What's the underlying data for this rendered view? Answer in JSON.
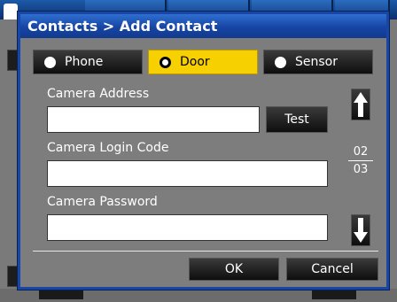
{
  "dialog": {
    "title": "Contacts > Add Contact",
    "types": [
      {
        "label": "Phone",
        "selected": false
      },
      {
        "label": "Door",
        "selected": true
      },
      {
        "label": "Sensor",
        "selected": false
      }
    ],
    "fields": {
      "camera_address": {
        "label": "Camera Address",
        "value": ""
      },
      "camera_login_code": {
        "label": "Camera Login Code",
        "value": ""
      },
      "camera_password": {
        "label": "Camera Password",
        "value": ""
      }
    },
    "test_label": "Test",
    "page": {
      "current": "02",
      "total": "03"
    },
    "ok_label": "OK",
    "cancel_label": "Cancel"
  },
  "colors": {
    "title_bar": "#1745a4",
    "selected_type": "#f6d000",
    "dialog_bg": "#7d7d7d"
  },
  "icons": [
    "up-arrow-icon",
    "down-arrow-icon",
    "radio-icon",
    "background-app-icon"
  ]
}
